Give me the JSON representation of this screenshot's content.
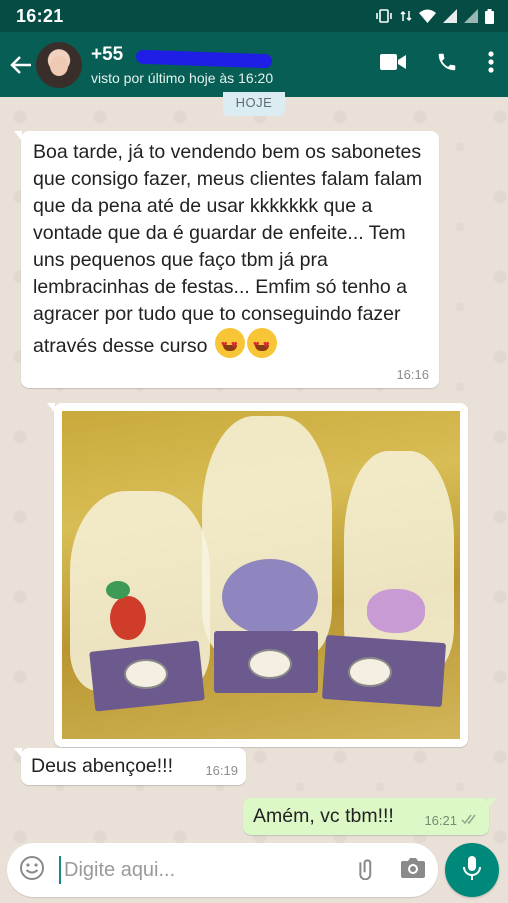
{
  "status_bar": {
    "time": "16:21"
  },
  "header": {
    "contact_name": "+55",
    "last_seen": "visto por último hoje às 16:20"
  },
  "chat": {
    "date_chip": "HOJE",
    "messages": [
      {
        "direction": "in",
        "type": "text",
        "text": "Boa tarde, já to vendendo bem os sabonetes que consigo fazer, meus clientes falam falam que da pena até de usar kkkkkkk que a vontade que da é guardar de enfeite... Tem uns pequenos que faço tbm já pra lembracinhas de festas... Emfim só tenho a agracer por tudo que to conseguindo fazer através desse curso",
        "emoji": [
          "heart-eyes",
          "heart-eyes"
        ],
        "time": "16:16"
      },
      {
        "direction": "in",
        "type": "image",
        "subject": "three gift-wrapped soaps in organza bags"
      },
      {
        "direction": "in",
        "type": "text",
        "text": "Deus abençoe!!!",
        "time": "16:19"
      },
      {
        "direction": "out",
        "type": "text",
        "text": "Amém, vc tbm!!!",
        "time": "16:21",
        "status": "read"
      }
    ]
  },
  "composer": {
    "placeholder": "Digite aqui..."
  },
  "icons": {
    "back": "arrow-left-icon",
    "video": "video-camera-icon",
    "call": "phone-icon",
    "menu": "more-vert-icon",
    "emoji": "smiley-icon",
    "attach": "paperclip-icon",
    "camera": "camera-icon",
    "mic": "microphone-icon"
  },
  "colors": {
    "header": "#075e54",
    "status_bar": "#054d44",
    "outgoing_bubble": "#dcf8c6",
    "mic_button": "#00897b"
  }
}
